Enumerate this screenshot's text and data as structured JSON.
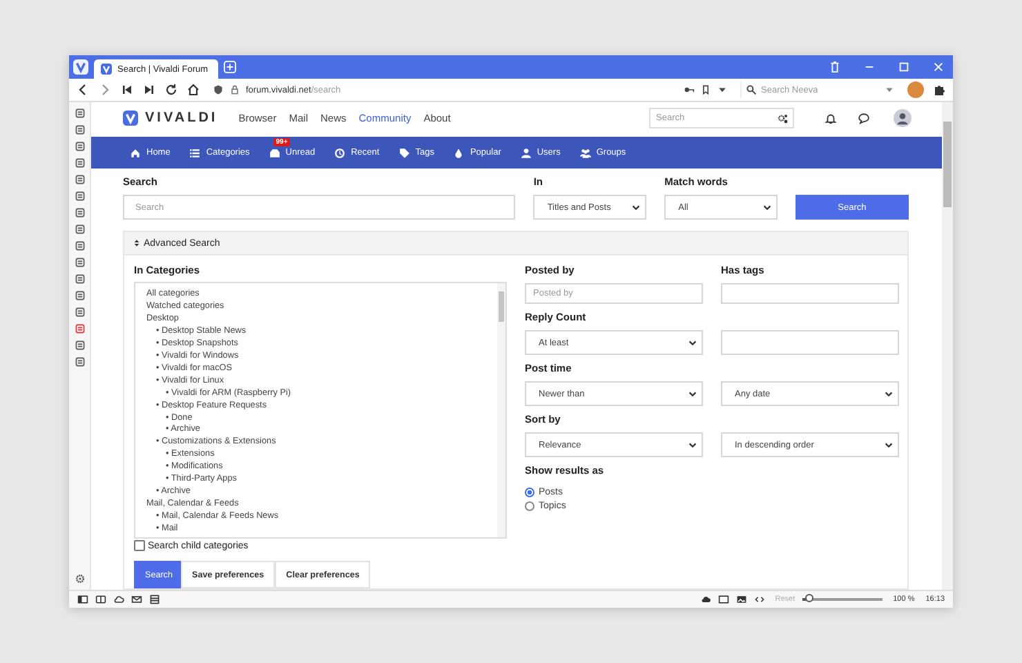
{
  "window": {
    "tab_title": "Search | Vivaldi Forum",
    "url_host": "forum.vivaldi.net",
    "url_path": "/search",
    "search_engine_placeholder": "Search Neeva"
  },
  "site": {
    "logo": "VIVALDI",
    "nav": [
      {
        "label": "Browser",
        "selected": false
      },
      {
        "label": "Mail",
        "selected": false
      },
      {
        "label": "News",
        "selected": false
      },
      {
        "label": "Community",
        "selected": true
      },
      {
        "label": "About",
        "selected": false
      }
    ],
    "search_placeholder": "Search"
  },
  "forum_nav": [
    {
      "label": "Home"
    },
    {
      "label": "Categories"
    },
    {
      "label": "Unread",
      "badge": "99+"
    },
    {
      "label": "Recent"
    },
    {
      "label": "Tags"
    },
    {
      "label": "Popular"
    },
    {
      "label": "Users"
    },
    {
      "label": "Groups"
    }
  ],
  "search": {
    "label": "Search",
    "placeholder": "Search",
    "in_label": "In",
    "in_value": "Titles and Posts",
    "match_label": "Match words",
    "match_value": "All",
    "button": "Search"
  },
  "advanced": {
    "title": "Advanced Search",
    "categories_label": "In Categories",
    "categories": [
      {
        "label": "All categories"
      },
      {
        "label": "Watched categories"
      },
      {
        "label": "Desktop",
        "children": [
          {
            "label": "• Desktop Stable News"
          },
          {
            "label": "• Desktop Snapshots"
          },
          {
            "label": "• Vivaldi for Windows"
          },
          {
            "label": "• Vivaldi for macOS"
          },
          {
            "label": "• Vivaldi for Linux",
            "children": [
              {
                "label": "• Vivaldi for ARM (Raspberry Pi)"
              }
            ]
          },
          {
            "label": "• Desktop Feature Requests",
            "children": [
              {
                "label": "• Done"
              },
              {
                "label": "• Archive"
              }
            ]
          },
          {
            "label": "• Customizations & Extensions",
            "children": [
              {
                "label": "• Extensions"
              },
              {
                "label": "• Modifications"
              },
              {
                "label": "• Third-Party Apps"
              }
            ]
          },
          {
            "label": "• Archive"
          }
        ]
      },
      {
        "label": "Mail, Calendar & Feeds",
        "children": [
          {
            "label": "• Mail, Calendar & Feeds News"
          },
          {
            "label": "• Mail"
          }
        ]
      }
    ],
    "child_categories": {
      "label": "Search child categories",
      "checked": false
    },
    "buttons": [
      {
        "label": "Search",
        "kind": "primary"
      },
      {
        "label": "Save preferences",
        "kind": "plain"
      },
      {
        "label": "Clear preferences",
        "kind": "plain"
      }
    ],
    "posted_by": {
      "label": "Posted by",
      "placeholder": "Posted by"
    },
    "has_tags": {
      "label": "Has tags"
    },
    "reply_count": {
      "label": "Reply Count",
      "value": "At least"
    },
    "post_time": {
      "label": "Post time",
      "value": "Newer than",
      "range": "Any date"
    },
    "sort_by": {
      "label": "Sort by",
      "value": "Relevance",
      "order": "In descending order"
    },
    "show_results": {
      "label": "Show results as",
      "options": [
        {
          "label": "Posts",
          "selected": true
        },
        {
          "label": "Topics",
          "selected": false
        }
      ]
    }
  },
  "status_bar": {
    "reset": "Reset",
    "zoom": {
      "level": 0.1
    },
    "zoom_text": "100 %",
    "clock": "16:13"
  }
}
